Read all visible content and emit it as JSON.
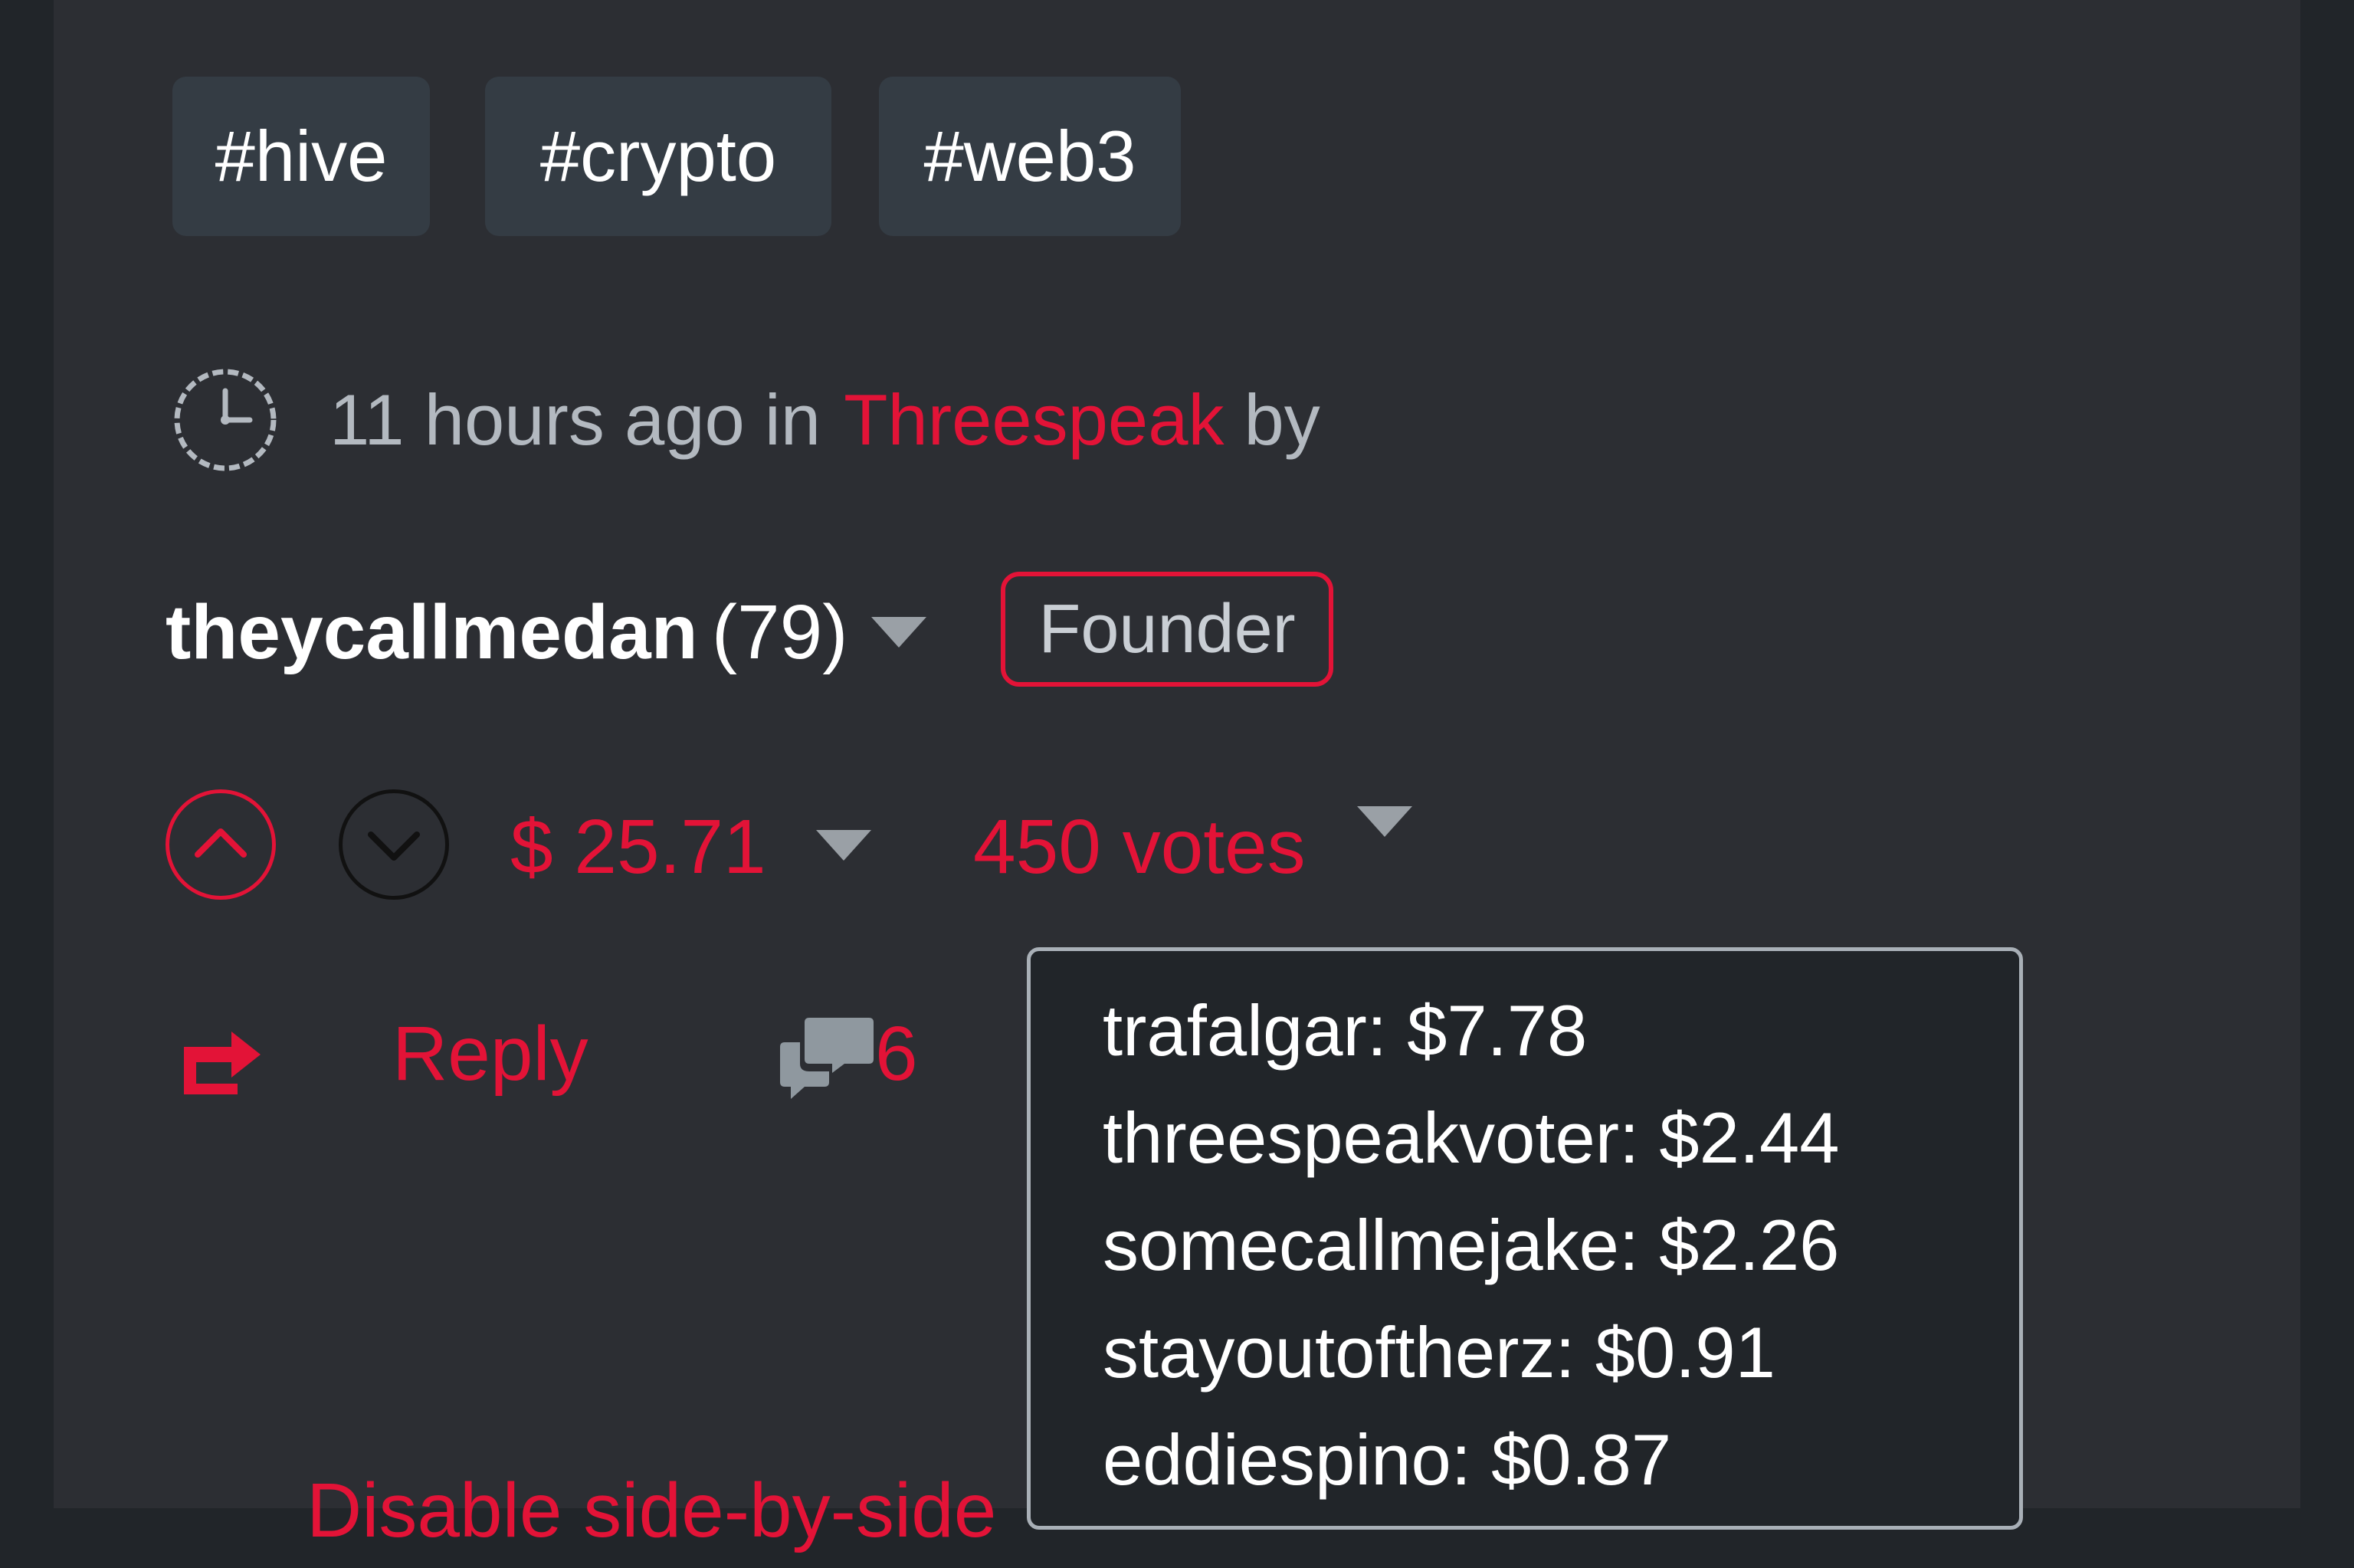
{
  "tags": [
    "#hive",
    "#crypto",
    "#web3"
  ],
  "meta": {
    "time_ago": "11 hours ago in",
    "community": "Threespeak",
    "by": "by"
  },
  "author": {
    "name": "theycallmedan",
    "reputation": "(79)",
    "badge": "Founder"
  },
  "payout": {
    "currency": "$",
    "amount": "25.71"
  },
  "votes": {
    "label": "450 votes",
    "voters": [
      "trafalgar: $7.78",
      "threespeakvoter: $2.44",
      "somecallmejake: $2.26",
      "stayoutoftherz: $0.91",
      "eddiespino: $0.87"
    ]
  },
  "actions": {
    "reply": "Reply",
    "comment_count": "6"
  },
  "footer": {
    "side_by_side": "Disable side-by-side"
  },
  "colors": {
    "accent": "#e31337",
    "background": "#2c2e33",
    "tag_bg": "#343c44",
    "popup_bg": "#212529"
  }
}
